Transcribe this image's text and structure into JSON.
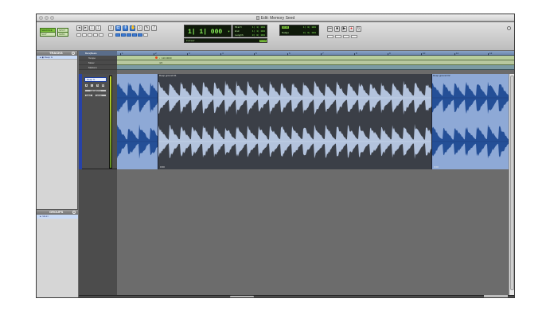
{
  "window": {
    "title": "Edit: Memory Seed"
  },
  "toolbar": {
    "shuffle_label": "SHUFFLE",
    "spot_label": "SPOT",
    "slip_label": "SLIP",
    "grid_label": "GRID",
    "main_counter": "1| 1| 000",
    "start_label": "Start",
    "end_label": "End",
    "length_label": "Length",
    "start_value": "1| 1| 000",
    "end_value": "1| 1| 000",
    "length_value": "0| 0| 000",
    "cursor_label": "Cursor",
    "grid_value": "1| 0| 000",
    "nudge_label": "Nudge",
    "nudge_value": "0| 0| 000",
    "grid_button": "Grid"
  },
  "left_panel": {
    "tracks_heading": "TRACKS",
    "tracks": [
      "Deep G"
    ],
    "groups_heading": "GROUPS",
    "groups": [
      "<ALL>"
    ]
  },
  "rulers": {
    "bars_beats_label": "Bars|Beats",
    "tempo_label": "Tempo",
    "meter_label": "Meter",
    "markers_label": "Markers",
    "tempo_value": "♩120.0000",
    "meter_value": "4/4",
    "bar_numbers": [
      "1",
      "2",
      "3",
      "4",
      "5",
      "6",
      "7",
      "8",
      "9",
      "10",
      "11",
      "12"
    ]
  },
  "track": {
    "name": "Deep G",
    "mode": "waveform",
    "input_selector": "read",
    "output_selector": "none",
    "color": "#2742a8",
    "clips": [
      {
        "name": "",
        "time": ""
      },
      {
        "name": "Deep ground 01",
        "time": "0:00"
      },
      {
        "name": "Deep ground 02",
        "time": "0:00"
      }
    ]
  },
  "colors": {
    "clip_light": "#8ea9d6",
    "clip_dark": "#3b3f47",
    "waveform_blue": "#1f4a93",
    "waveform_light": "#b9cae6",
    "transport_display": "#0f1a0a",
    "transport_text": "#8af25a"
  }
}
